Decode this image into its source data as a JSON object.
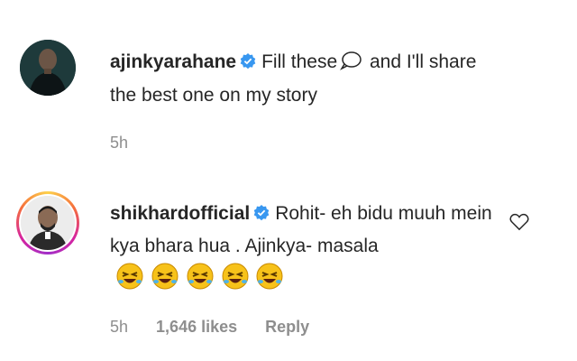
{
  "comments": [
    {
      "username": "ajinkyarahane",
      "text_before_icon": "Fill these",
      "text_after_icon": "and I'll share the best one on my story",
      "time": "5h"
    },
    {
      "username": "shikhardofficial",
      "text": "Rohit- eh bidu muuh mein kya bhara hua . Ajinkya- masala",
      "emoji_count": 5,
      "time": "5h",
      "likes": "1,646 likes",
      "reply_label": "Reply"
    }
  ],
  "icons": {
    "verified": "verified-badge-icon",
    "speech_bubble": "speech-bubble-icon",
    "emoji": "rolling-laughing-face-icon",
    "like": "heart-outline-icon"
  },
  "colors": {
    "verified_blue": "#3897f0",
    "meta_gray": "#8e8e8e",
    "text": "#262626"
  }
}
